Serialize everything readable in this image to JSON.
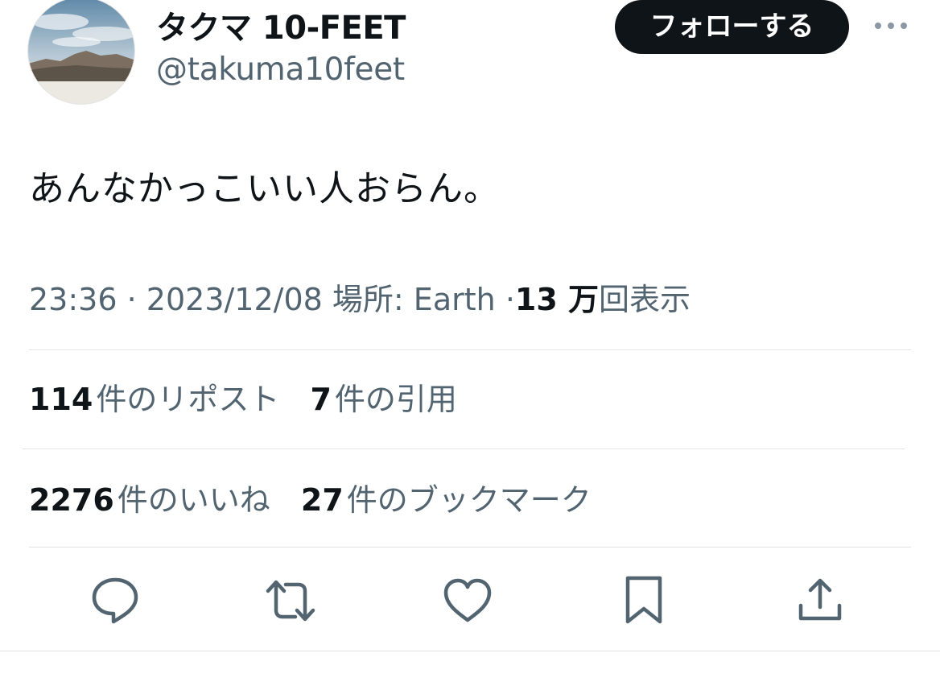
{
  "author": {
    "display_name": "タクマ 10-FEET",
    "handle": "@takuma10feet",
    "follow_label": "フォローする"
  },
  "tweet": {
    "text": "あんなかっこいい人おらん。",
    "time": "23:36",
    "date": "2023/12/08",
    "location_label": "場所: Earth",
    "views_count": "13 万",
    "views_suffix": "回表示",
    "separator": "·"
  },
  "stats": {
    "reposts_count": "114",
    "reposts_label": "件のリポスト",
    "quotes_count": "7",
    "quotes_label": "件の引用",
    "likes_count": "2276",
    "likes_label": "件のいいね",
    "bookmarks_count": "27",
    "bookmarks_label": "件のブックマーク"
  },
  "icons": {
    "more": "more-horizontal-icon",
    "reply": "reply-icon",
    "repost": "repost-icon",
    "like": "heart-icon",
    "bookmark": "bookmark-icon",
    "share": "share-icon"
  },
  "colors": {
    "text_primary": "#0f1419",
    "text_secondary": "#536471",
    "divider": "#e1e4e6",
    "follow_button_bg": "#0f1419"
  }
}
